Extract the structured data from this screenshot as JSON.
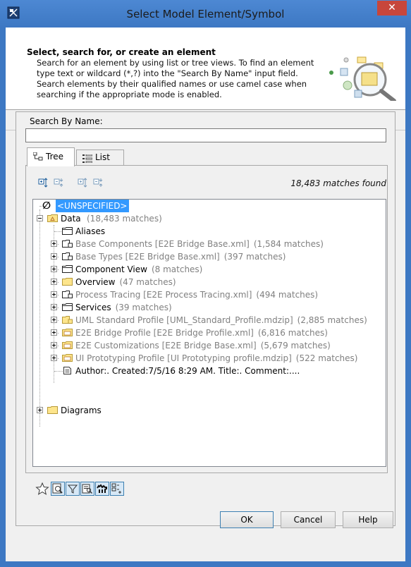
{
  "window": {
    "title": "Select Model Element/Symbol",
    "close_glyph": "✕"
  },
  "header": {
    "title": "Select, search for, or create an element",
    "description": "Search for an element by using list or tree views. To find an element type text or wildcard (*,?) into the \"Search By Name\" input field. Search elements by their qualified names or use camel case when searching if the appropriate mode is enabled."
  },
  "search": {
    "label": "Search By Name:",
    "value": ""
  },
  "tabs": [
    {
      "label": "Tree",
      "active": true,
      "icon": "tree-icon"
    },
    {
      "label": "List",
      "active": false,
      "icon": "list-icon"
    }
  ],
  "status": {
    "matches": "18,483 matches found"
  },
  "tree": {
    "unspecified": "<UNSPECIFIED>",
    "data_label": "Data",
    "data_count": "(18,483 matches)",
    "children": [
      {
        "name": "Aliases",
        "extra": "",
        "grey": false,
        "expandable": false,
        "icon": "folder-dark"
      },
      {
        "name": "Base Components [E2E Bridge Base.xml]",
        "extra": "(1,584 matches)",
        "grey": true,
        "expandable": true,
        "icon": "package-dark"
      },
      {
        "name": "Base Types [E2E Bridge Base.xml]",
        "extra": "(397 matches)",
        "grey": true,
        "expandable": true,
        "icon": "package-dark"
      },
      {
        "name": "Component View",
        "extra": "(8 matches)",
        "grey": false,
        "expandable": true,
        "icon": "folder-dark"
      },
      {
        "name": "Overview",
        "extra": "(47 matches)",
        "grey": false,
        "expandable": true,
        "icon": "folder-yellow"
      },
      {
        "name": "Process Tracing [E2E Process Tracing.xml]",
        "extra": "(494 matches)",
        "grey": true,
        "expandable": true,
        "icon": "package-dark"
      },
      {
        "name": "Services",
        "extra": "(39 matches)",
        "grey": false,
        "expandable": true,
        "icon": "folder-dark"
      },
      {
        "name": "UML Standard Profile [UML_Standard_Profile.mdzip]",
        "extra": "(2,885 matches)",
        "grey": true,
        "expandable": true,
        "icon": "package-yellow"
      },
      {
        "name": "E2E Bridge Profile [E2E Bridge Profile.xml]",
        "extra": "(6,816 matches)",
        "grey": true,
        "expandable": true,
        "icon": "profile-yellow"
      },
      {
        "name": "E2E Customizations [E2E Bridge Base.xml]",
        "extra": "(5,679 matches)",
        "grey": true,
        "expandable": true,
        "icon": "profile-yellow"
      },
      {
        "name": "UI Prototyping Profile [UI Prototyping profile.mdzip]",
        "extra": "(522 matches)",
        "grey": true,
        "expandable": true,
        "icon": "profile-yellow"
      },
      {
        "name": "Author:. Created:7/5/16 8:29 AM. Title:. Comment:....",
        "extra": "",
        "grey": false,
        "expandable": false,
        "icon": "comment"
      }
    ],
    "diagrams_label": "Diagrams"
  },
  "buttons": {
    "ok": "OK",
    "cancel": "Cancel",
    "help": "Help"
  },
  "colors": {
    "title_bar": "#3d78c3",
    "close": "#c7463b",
    "selection": "#3399ff"
  }
}
